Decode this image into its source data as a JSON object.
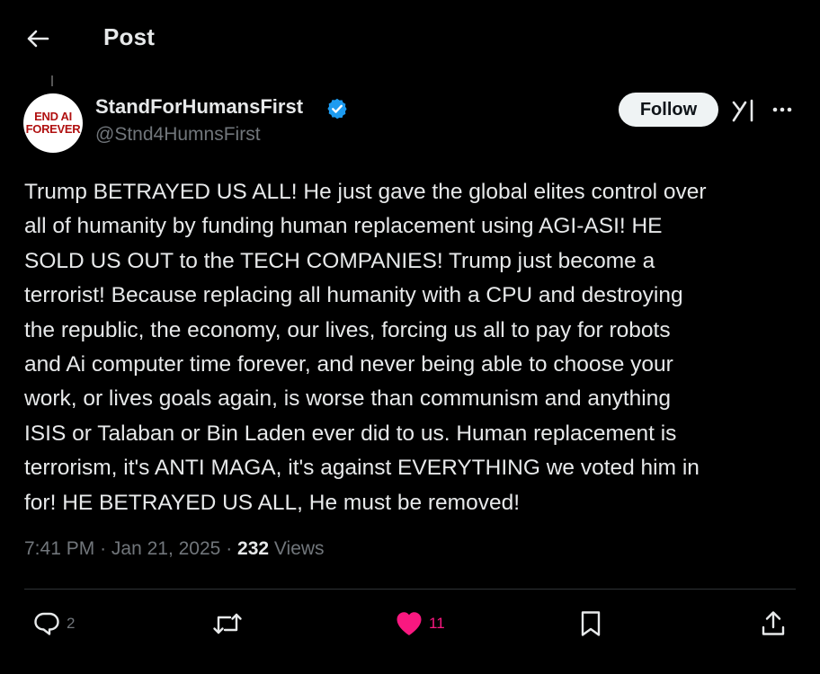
{
  "header": {
    "title": "Post",
    "back_icon": "arrow-left-icon"
  },
  "author": {
    "avatar_text_line1": "END AI",
    "avatar_text_line2": "FOREVER",
    "display_name": "StandForHumansFirst",
    "handle": "@Stnd4HumnsFirst",
    "verified": true,
    "verified_color": "#1d9bf0"
  },
  "actions_top": {
    "follow_label": "Follow",
    "grok_icon": "grok-icon",
    "more_icon": "more-horizontal-icon"
  },
  "post": {
    "text": "Trump BETRAYED US ALL! He just gave the global elites control over\nall of humanity by funding human replacement using AGI-ASI! HE\nSOLD US OUT to the TECH COMPANIES!  Trump just become a\nterrorist! Because replacing all humanity with a CPU and destroying\nthe republic, the economy, our lives, forcing us all to pay for robots\nand Ai computer time forever, and never being able to choose your\nwork, or lives goals again, is worse than communism and anything\nISIS or Talaban or Bin Laden ever did to us.  Human replacement is\nterrorism, it's ANTI MAGA, it's against EVERYTHING we voted him in\nfor! HE BETRAYED US ALL, He must be removed!",
    "time": "7:41 PM",
    "date": "Jan 21, 2025",
    "separator": "·",
    "views_count": "232",
    "views_label": "Views"
  },
  "engagement": {
    "replies": "2",
    "reposts": "",
    "likes": "11",
    "liked": true,
    "like_color": "#f91880",
    "icons": [
      "reply-icon",
      "repost-icon",
      "heart-icon",
      "bookmark-icon",
      "share-icon"
    ]
  },
  "colors": {
    "background": "#000000",
    "text_primary": "#e7e9ea",
    "text_secondary": "#71767b",
    "divider": "#2f3336",
    "avatar_text": "#b01010"
  }
}
